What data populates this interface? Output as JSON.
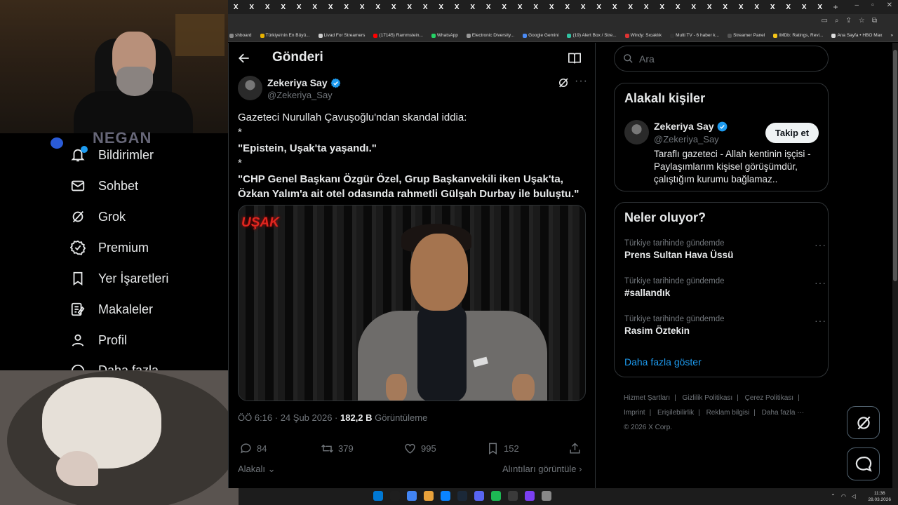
{
  "browser": {
    "tab_close_glyph": "X",
    "tab_count": 38,
    "new_tab_glyph": "+",
    "window_controls": [
      "–",
      "▫",
      "✕"
    ],
    "bookmarks": [
      {
        "label": "shboard",
        "color": "#888"
      },
      {
        "label": "Türkiye'nin En Büyü...",
        "color": "#e8b200"
      },
      {
        "label": "Livad For Streamers",
        "color": "#ccc"
      },
      {
        "label": "(17145) Rammstein...",
        "color": "#ff0000"
      },
      {
        "label": "WhatsApp",
        "color": "#25d366"
      },
      {
        "label": "Electronic Diversity...",
        "color": "#999"
      },
      {
        "label": "Google Gemini",
        "color": "#4b8bf5"
      },
      {
        "label": "(19) Alert Box / Stre...",
        "color": "#31c3a2"
      },
      {
        "label": "Windy: Sıcaklık",
        "color": "#d33"
      },
      {
        "label": "Multi TV - 6 haber k...",
        "color": "#333"
      },
      {
        "label": "Streamer Panel",
        "color": "#555"
      },
      {
        "label": "IMDb: Ratings, Revi...",
        "color": "#f5c518"
      },
      {
        "label": "Ana Sayfa • HBO Max",
        "color": "#ddd"
      }
    ],
    "bookmarks_more": "»",
    "all_bookmarks": "Tüm Yer İşaretleri"
  },
  "webcam": {
    "overlay_text": "NEGAN"
  },
  "nav": {
    "items": [
      {
        "label": "Bildirimler",
        "icon": "bell-icon"
      },
      {
        "label": "Sohbet",
        "icon": "mail-icon"
      },
      {
        "label": "Grok",
        "icon": "grok-icon"
      },
      {
        "label": "Premium",
        "icon": "verified-badge-icon"
      },
      {
        "label": "Yer İşaretleri",
        "icon": "bookmark-icon"
      },
      {
        "label": "Makaleler",
        "icon": "article-icon"
      },
      {
        "label": "Profil",
        "icon": "person-icon"
      },
      {
        "label": "Daha fazla",
        "icon": "more-circle-icon"
      }
    ]
  },
  "post": {
    "header_title": "Gönderi",
    "author_name": "Zekeriya Say",
    "author_handle": "@Zekeriya_Say",
    "lines": [
      "Gazeteci Nurullah Çavuşoğlu'ndan skandal iddia:",
      "*",
      "\"Epistein, Uşak'ta yaşandı.\"",
      "*",
      "\"CHP Genel Başkanı Özgür Özel, Grup Başkanvekili iken Uşak'ta, Özkan Yalım'a ait otel odasında rahmetli Gülşah Durbay ile buluştu.\""
    ],
    "media_logo": "UŞAK",
    "time": "ÖÖ 6:16",
    "date": "24 Şub 2026",
    "views": "182,2 B",
    "views_label": "Görüntüleme",
    "replies": "84",
    "reposts": "379",
    "likes": "995",
    "bookmarks": "152",
    "related_label": "Alakalı",
    "quotes_label": "Alıntıları görüntüle"
  },
  "sidebar": {
    "search_placeholder": "Ara",
    "related_title": "Alakalı kişiler",
    "related_person": {
      "name": "Zekeriya Say",
      "handle": "@Zekeriya_Say",
      "follow_label": "Takip et",
      "bio": "Taraflı gazeteci - Allah kentinin işçisi - Paylaşımlarım kişisel görüşümdür, çalıştığım kurumu bağlamaz.."
    },
    "trends_title": "Neler oluyor?",
    "trends": [
      {
        "context": "Türkiye tarihinde gündemde",
        "name": "Prens Sultan Hava Üssü"
      },
      {
        "context": "Türkiye tarihinde gündemde",
        "name": "#sallandık"
      },
      {
        "context": "Türkiye tarihinde gündemde",
        "name": "Rasim Öztekin"
      }
    ],
    "show_more": "Daha fazla göster",
    "footer_links": [
      "Hizmet Şartları",
      "Gizlilik Politikası",
      "Çerez Politikası",
      "Imprint",
      "Erişilebilirlik",
      "Reklam bilgisi",
      "Daha fazla ···"
    ],
    "copyright": "© 2026 X Corp."
  },
  "taskbar": {
    "time": "11:36",
    "date": "28.03.2026",
    "app_colors": [
      "#0078d4",
      "#1e1e1e",
      "#4285f4",
      "#e9a23b",
      "#0a84ff",
      "#1b2838",
      "#5865f2",
      "#1db954",
      "#3a3a3a",
      "#7b3ff2",
      "#888"
    ]
  },
  "colors": {
    "accent": "#1d9bf0",
    "background": "#000000",
    "text": "#e7e9ea",
    "muted": "#71767b"
  }
}
